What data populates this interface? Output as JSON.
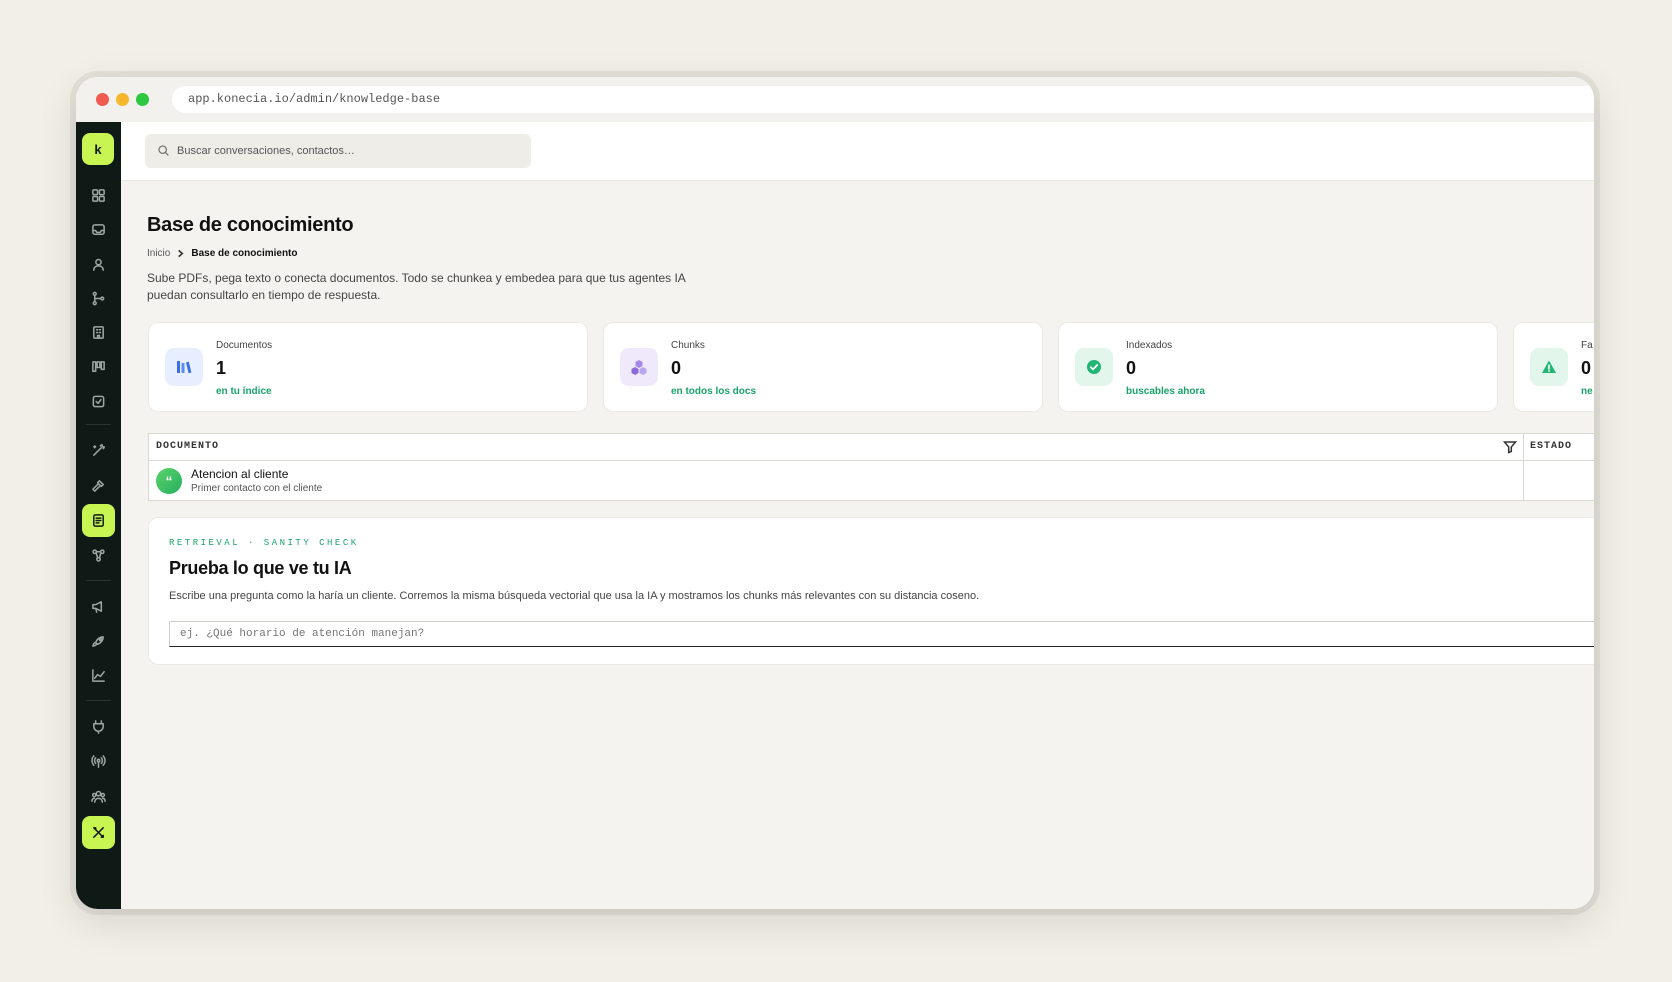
{
  "browser": {
    "url": "app.konecia.io/admin/knowledge-base"
  },
  "sidebar": {
    "logo": "k",
    "items": [
      {
        "name": "dashboard-icon"
      },
      {
        "name": "inbox-icon"
      },
      {
        "name": "contacts-icon"
      },
      {
        "name": "flows-icon"
      },
      {
        "name": "companies-icon"
      },
      {
        "name": "pipeline-icon"
      },
      {
        "name": "tasks-icon"
      },
      {
        "name": "ai-wand-icon"
      },
      {
        "name": "tools-icon"
      },
      {
        "name": "knowledge-base-icon",
        "active": true
      },
      {
        "name": "integrations-icon"
      },
      {
        "name": "campaigns-icon"
      },
      {
        "name": "launch-icon"
      },
      {
        "name": "analytics-icon"
      },
      {
        "name": "plugins-icon"
      },
      {
        "name": "channels-icon"
      },
      {
        "name": "team-icon"
      },
      {
        "name": "settings-icon",
        "active": true
      }
    ]
  },
  "search": {
    "placeholder": "Buscar conversaciones, contactos…"
  },
  "page": {
    "title": "Base de conocimiento",
    "breadcrumb": {
      "home": "Inicio",
      "current": "Base de conocimiento"
    },
    "description": "Sube PDFs, pega texto o conecta documentos. Todo se chunkea y embedea para que tus agentes IA puedan consultarlo en tiempo de respuesta."
  },
  "stats": [
    {
      "label": "Documentos",
      "value": "1",
      "sub": "en tu índice",
      "icon": "books-icon",
      "color": "#3b6ee0",
      "bg": "#e6eeff"
    },
    {
      "label": "Chunks",
      "value": "0",
      "sub": "en todos los docs",
      "icon": "cubes-icon",
      "color": "#8a6ad8",
      "bg": "#efe9fb"
    },
    {
      "label": "Indexados",
      "value": "0",
      "sub": "buscables ahora",
      "icon": "check-circle-icon",
      "color": "#22b573",
      "bg": "#e2f6ec"
    },
    {
      "label": "Fa",
      "value": "0",
      "sub": "ne",
      "icon": "warning-icon",
      "color": "#22b573",
      "bg": "#e2f6ec"
    }
  ],
  "table": {
    "columns": [
      "DOCUMENTO",
      "ESTADO"
    ],
    "rows": [
      {
        "avatar": "“",
        "title": "Atencion al cliente",
        "subtitle": "Primer contacto con el cliente"
      }
    ]
  },
  "retrieval": {
    "eyebrow": "RETRIEVAL · SANITY CHECK",
    "title": "Prueba lo que ve tu IA",
    "description": "Escribe una pregunta como la haría un cliente. Corremos la misma búsqueda vectorial que usa la IA y mostramos los chunks más relevantes con su distancia coseno.",
    "placeholder": "ej. ¿Qué horario de atención manejan?"
  }
}
